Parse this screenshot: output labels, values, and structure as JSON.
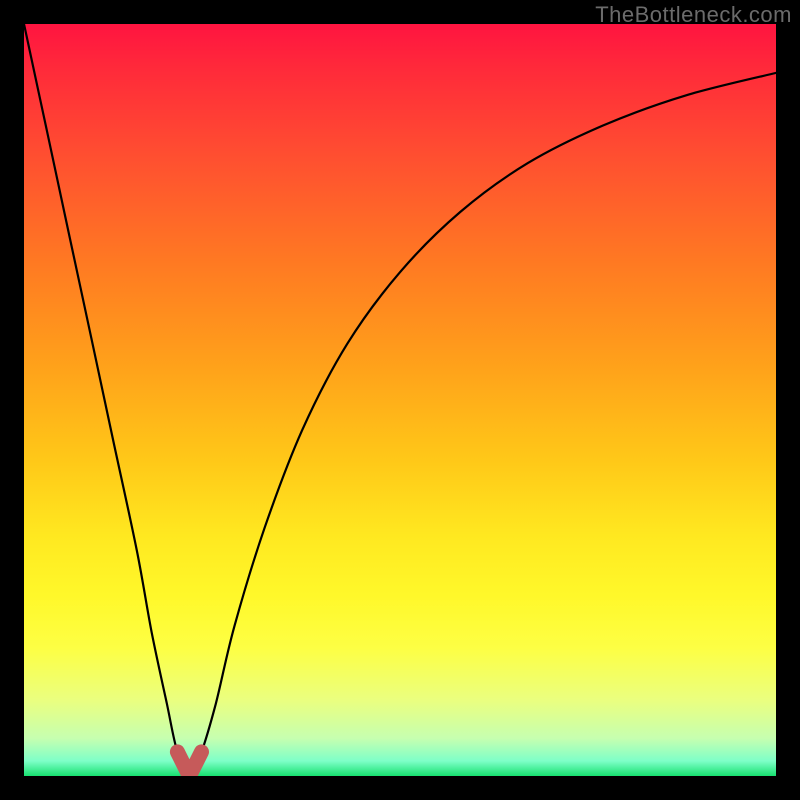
{
  "watermark": "TheBottleneck.com",
  "chart_data": {
    "type": "line",
    "title": "",
    "xlabel": "",
    "ylabel": "",
    "xlim": [
      0,
      1
    ],
    "ylim": [
      0,
      1
    ],
    "grid": false,
    "legend": false,
    "annotations": [],
    "series": [
      {
        "name": "curves",
        "color": "#000000",
        "x": [
          0.0,
          0.03,
          0.06,
          0.09,
          0.12,
          0.15,
          0.17,
          0.19,
          0.204,
          0.22,
          0.236,
          0.255,
          0.28,
          0.32,
          0.37,
          0.43,
          0.5,
          0.58,
          0.67,
          0.77,
          0.88,
          1.0
        ],
        "y": [
          1.0,
          0.86,
          0.72,
          0.58,
          0.44,
          0.3,
          0.19,
          0.096,
          0.032,
          0.0,
          0.032,
          0.096,
          0.2,
          0.33,
          0.46,
          0.575,
          0.67,
          0.75,
          0.815,
          0.865,
          0.905,
          0.935
        ],
        "note": "y = 0 at x≈0.22 (trough); y = 1 at top of plot; values are fractions of plot height from bottom"
      },
      {
        "name": "trough-highlight",
        "type": "marker",
        "color": "#cd5c5c",
        "x": [
          0.204,
          0.22,
          0.236
        ],
        "y": [
          0.032,
          0.0,
          0.032
        ],
        "note": "short U-shaped salmon segment at the minimum"
      }
    ]
  }
}
